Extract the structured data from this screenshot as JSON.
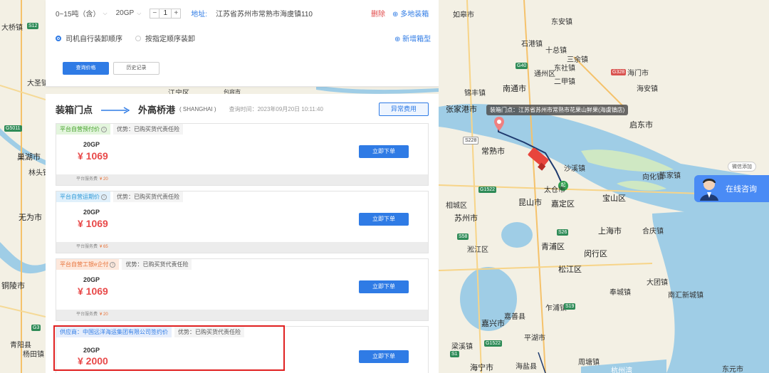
{
  "form": {
    "weight": "0~15吨（含）",
    "container_type": "20GP",
    "quantity": "1",
    "minus": "−",
    "plus": "+",
    "address_label": "地址:",
    "address_value": "江苏省苏州市常熟市海虞镇110",
    "delete_label": "删除",
    "multi_load_label": "⊕ 多地装箱",
    "radio_self": "司机自行装卸顺序",
    "radio_order": "按指定顺序装卸",
    "add_box_label": "⊕ 新增箱型",
    "query_button": "查询价格",
    "history_button": "历史记录"
  },
  "route": {
    "from": "装箱门点",
    "to": "外高桥港",
    "code": "( SHANGHAI )",
    "query_time": "查询时间：2023年09月20日 10:11:40",
    "abnormal_button": "异常费用"
  },
  "cards": [
    {
      "tag": "平台自营预付价",
      "tag_style": "green",
      "advantage": "优势：已购买货代责任险",
      "box": "20GP",
      "price": "¥ 1069",
      "order_button": "立即下单",
      "fee_label": "平台服务费",
      "fee_value": "¥ 20"
    },
    {
      "tag": "平台自营运期价",
      "tag_style": "blue",
      "advantage": "优势：已购买货代责任险",
      "box": "20GP",
      "price": "¥ 1069",
      "order_button": "立即下单",
      "fee_label": "平台服务费",
      "fee_value": "¥ 65"
    },
    {
      "tag": "平台自营工银e企付",
      "tag_style": "orange",
      "advantage": "优势：已购买货代责任险",
      "box": "20GP",
      "price": "¥ 1069",
      "order_button": "立即下单",
      "fee_label": "平台服务费",
      "fee_value": "¥ 20"
    },
    {
      "tag": "供应商：中国远洋海运集团有限公司签约价",
      "tag_style": "supplier",
      "advantage": "优势：已购买货代责任险",
      "box": "20GP",
      "price": "¥ 2000",
      "order_button": "立即下单"
    }
  ],
  "map": {
    "tooltip": "装箱门点：江苏省苏州市常熟市花果山鲜果(海虞镇店)",
    "start_marker": "起",
    "labels_right": [
      "如皋市",
      "东安镇",
      "石港镇",
      "十总镇",
      "三余镇",
      "东社镇",
      "二甲镇",
      "通州区",
      "南通市",
      "海门市",
      "锦丰镇",
      "海安镇",
      "张家港市",
      "启东市",
      "常熟市",
      "沙溪镇",
      "向化镇",
      "陈家镇",
      "太仓市",
      "嘉定区",
      "宝山区",
      "昆山市",
      "苏州市",
      "相城区",
      "淞江区",
      "青浦区",
      "闵行区",
      "上海市",
      "松江区",
      "合庆镇",
      "南汇新城镇",
      "奉城镇",
      "大团镇",
      "乍浦镇",
      "平湖市",
      "嘉兴市",
      "海宁市",
      "嘉善县",
      "海盐县",
      "梁溪镇",
      "杭州湾",
      "周塘镇",
      "东元市"
    ],
    "labels_left": [
      "大桥镇",
      "大圣镇",
      "巢湖市",
      "林头镇",
      "无为市",
      "铜陵市",
      "青阳县",
      "杨田镇",
      "江宁区",
      "包容市"
    ],
    "consult_text": "在线咨询",
    "wechat_text": "微信添加"
  },
  "colors": {
    "primary": "#2f7be5",
    "price_red": "#e84a4a",
    "highlight": "#e02020"
  }
}
